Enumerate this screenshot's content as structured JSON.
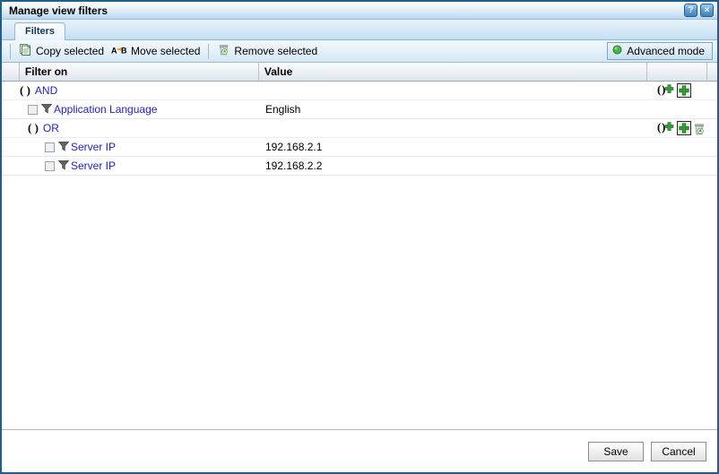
{
  "window": {
    "title": "Manage view filters",
    "help_button": "?",
    "close_button": "×"
  },
  "tabs": [
    {
      "label": "Filters",
      "active": true
    }
  ],
  "toolbar": {
    "copy_selected": "Copy selected",
    "move_selected": "Move selected",
    "remove_selected": "Remove selected",
    "advanced_mode": "Advanced mode",
    "icons": {
      "copy": "copy-document-icon",
      "move": "move-a-to-b-icon",
      "remove": "trash-icon",
      "advanced": "green-bullet-icon"
    }
  },
  "grid": {
    "columns": [
      "Filter on",
      "Value",
      ""
    ],
    "rows": [
      {
        "type": "group",
        "indent": 0,
        "paren": "( )",
        "operator": "AND",
        "value": "",
        "add_group": "()+",
        "add_filter": "+",
        "has_trash": false
      },
      {
        "type": "filter",
        "indent": 1,
        "checkbox": false,
        "field": "Application Language",
        "value": "English",
        "has_trash": false
      },
      {
        "type": "group",
        "indent": 1,
        "paren": "( )",
        "operator": "OR",
        "value": "",
        "add_group": "()+",
        "add_filter": "+",
        "has_trash": true
      },
      {
        "type": "filter",
        "indent": 2,
        "checkbox": false,
        "field": "Server IP",
        "value": "192.168.2.1",
        "has_trash": false
      },
      {
        "type": "filter",
        "indent": 2,
        "checkbox": false,
        "field": "Server IP",
        "value": "192.168.2.2",
        "has_trash": false
      }
    ]
  },
  "footer": {
    "save": "Save",
    "cancel": "Cancel"
  },
  "colors": {
    "link": "#2121c8",
    "border": "#1f5f8b",
    "accent_green": "#3aa03a",
    "titlebar_top": "#ffffff",
    "titlebar_bottom": "#b9d7ee"
  }
}
